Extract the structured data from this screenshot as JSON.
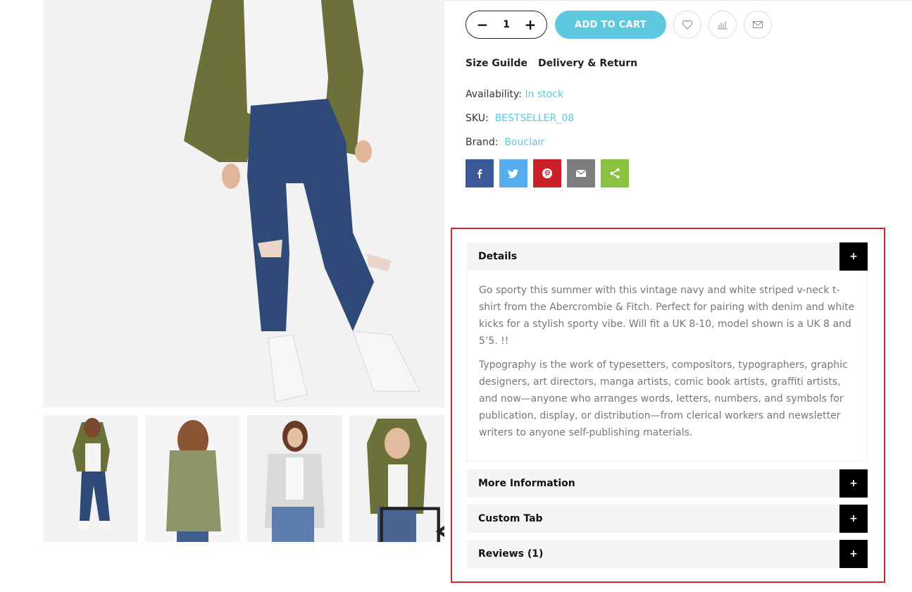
{
  "purchase": {
    "quantity": "1",
    "decrement_symbol": "−",
    "increment_symbol": "+",
    "add_to_cart_label": "ADD TO CART"
  },
  "action_icons": [
    "heart-icon",
    "compare-icon",
    "envelope-icon"
  ],
  "links": {
    "size_guide": "Size Guilde",
    "delivery_return": "Delivery & Return"
  },
  "meta": {
    "availability_label": "Availability:",
    "availability_value": "In stock",
    "sku_label": "SKU:",
    "sku_value": "BESTSELLER_08",
    "brand_label": "Brand:",
    "brand_value": "Bouclair"
  },
  "share_buttons": [
    {
      "name": "facebook",
      "color": "#3b5998"
    },
    {
      "name": "twitter",
      "color": "#55acee"
    },
    {
      "name": "pinterest",
      "color": "#cb2027"
    },
    {
      "name": "email",
      "color": "#7d7d7d"
    },
    {
      "name": "share",
      "color": "#8ac33f"
    }
  ],
  "accordion": {
    "details_title": "Details",
    "details_text_1": "Go sporty this summer with this vintage navy and white striped v-neck t-shirt from the Abercrombie & Fitch. Perfect for pairing with denim and white kicks for a stylish sporty vibe. Will fit a UK 8-10, model shown is a UK 8 and 5’5. !!",
    "details_text_2": "Typography is the work of typesetters, compositors, typographers, graphic designers, art directors, manga artists, comic book artists, graffiti artists, and now—anyone who arranges words, letters, numbers, and symbols for publication, display, or distribution—from clerical workers and newsletter writers to anyone self-publishing materials.",
    "more_info_title": "More Information",
    "custom_tab_title": "Custom Tab",
    "reviews_title": "Reviews (1)",
    "toggle_symbol": "+"
  },
  "colors": {
    "accent": "#5ec8de",
    "highlight_border": "#d9232d",
    "accordion_header_bg": "#f5f5f7"
  },
  "gallery": {
    "thumbnail_count": 4,
    "video_thumbnail_index": 4
  }
}
